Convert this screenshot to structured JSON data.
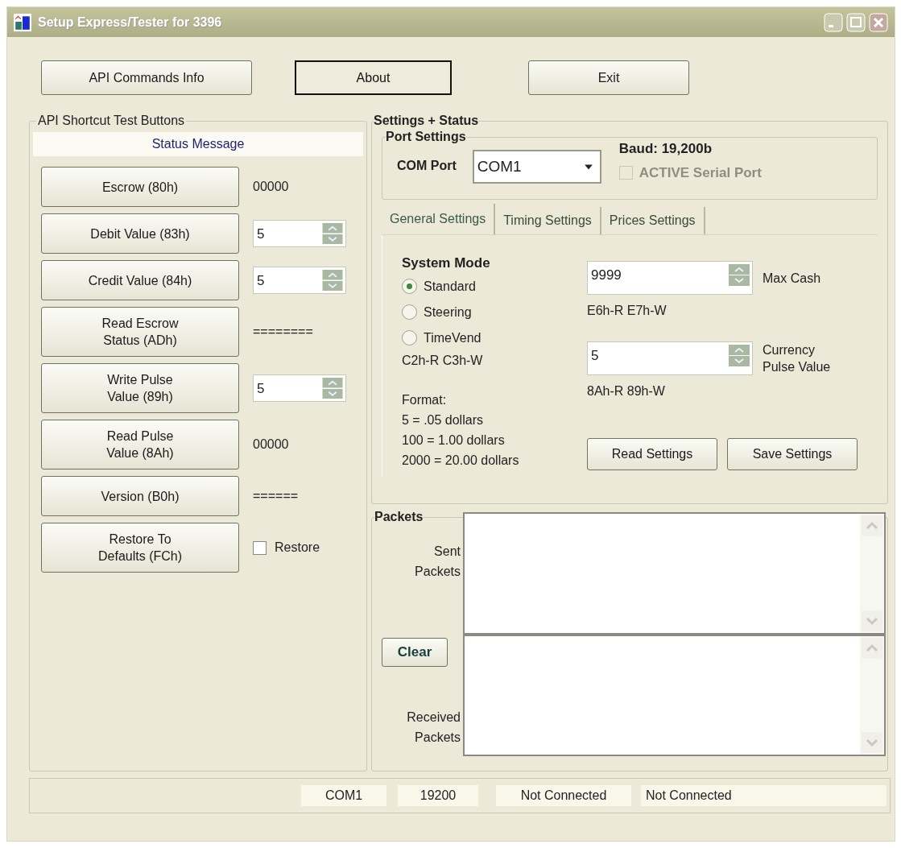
{
  "window": {
    "title": "Setup Express/Tester for 3396"
  },
  "top_buttons": [
    {
      "label": "API Commands Info",
      "focused": false
    },
    {
      "label": "About",
      "focused": true
    },
    {
      "label": "Exit",
      "focused": false
    }
  ],
  "api_shortcuts": {
    "title": "API Shortcut Test Buttons",
    "status_message": "Status Message",
    "rows": [
      {
        "button": [
          "Escrow (80h)"
        ],
        "kind": "text",
        "value": "00000"
      },
      {
        "button": [
          "Debit Value (83h)"
        ],
        "kind": "spinner",
        "value": "5"
      },
      {
        "button": [
          "Credit Value (84h)"
        ],
        "kind": "spinner",
        "value": "5"
      },
      {
        "button": [
          "Read Escrow",
          "Status (ADh)"
        ],
        "kind": "text",
        "value": "========"
      },
      {
        "button": [
          "Write Pulse",
          "Value (89h)"
        ],
        "kind": "spinner",
        "value": "5"
      },
      {
        "button": [
          "Read Pulse",
          "Value (8Ah)"
        ],
        "kind": "text",
        "value": "00000"
      },
      {
        "button": [
          "Version (B0h)"
        ],
        "kind": "text",
        "value": "======"
      },
      {
        "button": [
          "Restore To",
          "Defaults (FCh)"
        ],
        "kind": "checkbox",
        "value": "Restore",
        "checked": false
      }
    ]
  },
  "settings": {
    "title": "Settings + Status",
    "port_settings": {
      "title": "Port Settings",
      "com_label": "COM Port",
      "com_value": "COM1",
      "baud": "Baud: 19,200b",
      "active": {
        "label": "ACTIVE Serial Port",
        "checked": false,
        "disabled": true
      }
    },
    "tabs": [
      {
        "label": "General Settings",
        "selected": true
      },
      {
        "label": "Timing Settings",
        "selected": false
      },
      {
        "label": "Prices Settings",
        "selected": false
      }
    ],
    "general": {
      "system_mode": {
        "title": "System Mode",
        "options": [
          {
            "label": "Standard",
            "selected": true
          },
          {
            "label": "Steering",
            "selected": false
          },
          {
            "label": "TimeVend",
            "selected": false
          }
        ],
        "codes": "C2h-R C3h-W"
      },
      "format_lines": [
        "Format:",
        "5 = .05 dollars",
        "100 = 1.00 dollars",
        "2000 = 20.00 dollars"
      ],
      "max_cash": {
        "value": "9999",
        "label": [
          "Max Cash"
        ],
        "codes": "E6h-R E7h-W"
      },
      "pulse": {
        "value": "5",
        "label": [
          "Currency",
          "Pulse Value"
        ],
        "codes": "8Ah-R 89h-W"
      },
      "buttons": [
        "Read Settings",
        "Save Settings"
      ]
    }
  },
  "packets": {
    "title": "Packets",
    "sent_label": [
      "Sent",
      "Packets"
    ],
    "clear": "Clear",
    "received_label": [
      "Received",
      "Packets"
    ]
  },
  "status_bar": [
    "COM1",
    "19200",
    "Not Connected",
    "Not Connected"
  ]
}
